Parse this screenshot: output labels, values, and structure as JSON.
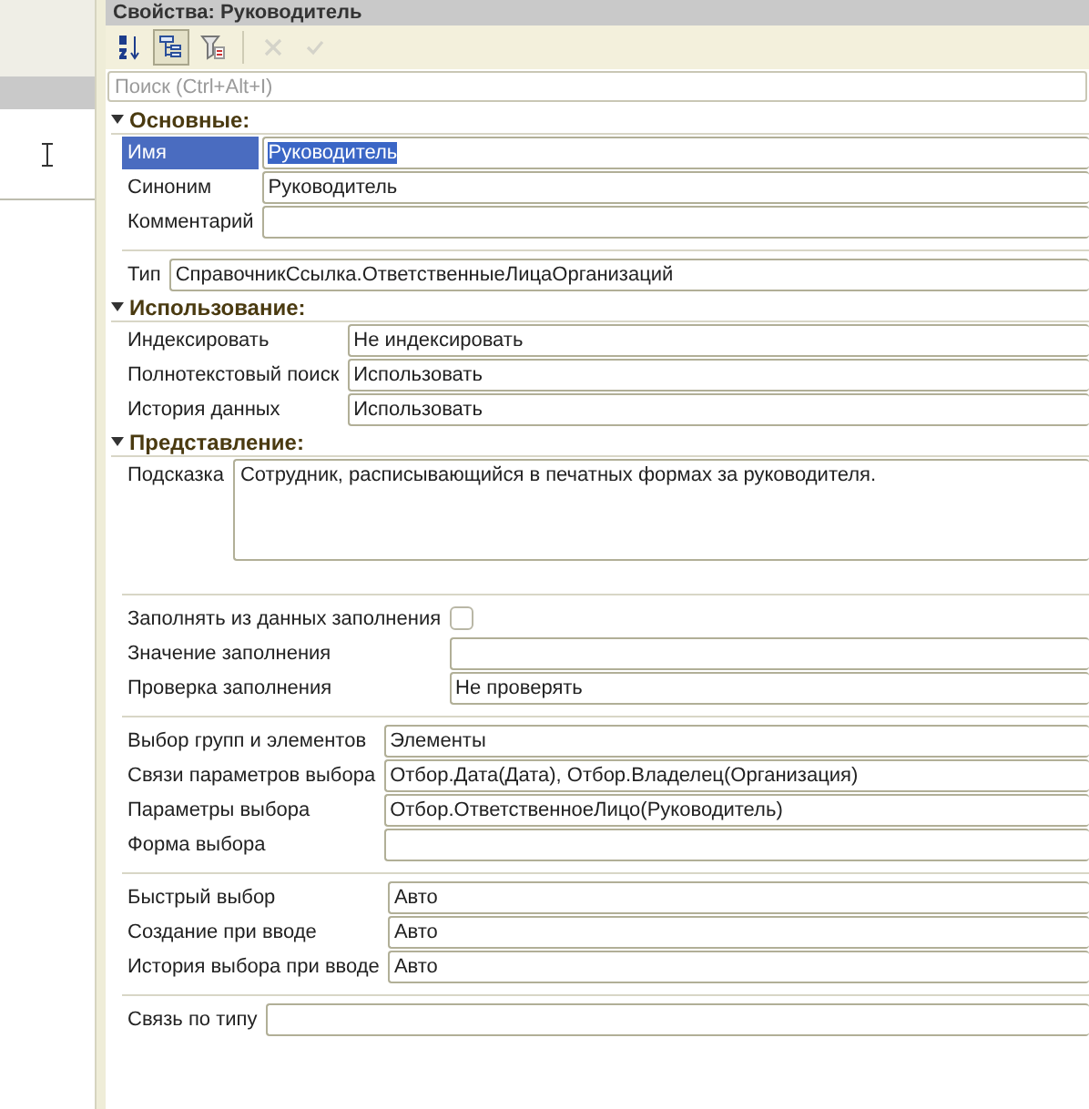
{
  "window": {
    "title": "Свойства: Руководитель"
  },
  "toolbar": [
    {
      "kind": "sort",
      "pressed": false,
      "disabled": false
    },
    {
      "kind": "tree",
      "pressed": true,
      "disabled": false
    },
    {
      "kind": "filter",
      "pressed": false,
      "disabled": false
    },
    {
      "kind": "delete",
      "pressed": false,
      "disabled": true
    },
    {
      "kind": "apply",
      "pressed": false,
      "disabled": true
    }
  ],
  "search": {
    "placeholder": "Поиск (Ctrl+Alt+I)"
  },
  "groups": [
    {
      "header": "Основные:",
      "expanded": true,
      "rows": [
        {
          "kind": "field",
          "label": "Имя",
          "value": "Руководитель",
          "selected": true
        },
        {
          "kind": "field",
          "label": "Синоним",
          "value": "Руководитель",
          "selected": false
        },
        {
          "kind": "field",
          "label": "Комментарий",
          "selected": false
        }
      ]
    },
    {
      "rows": [
        {
          "kind": "field",
          "label": "Тип",
          "value": "СправочникСсылка.ОтветственныеЛицаОрганизаций",
          "selected": false
        }
      ]
    },
    {
      "header": "Использование:",
      "expanded": true,
      "rows": [
        {
          "kind": "field",
          "label": "Индексировать",
          "value": "Не индексировать",
          "selected": false
        },
        {
          "kind": "field",
          "label": "Полнотекстовый поиск",
          "value": "Использовать",
          "selected": false
        },
        {
          "kind": "field",
          "label": "История данных",
          "value": "Использовать",
          "selected": false
        }
      ]
    },
    {
      "header": "Представление:",
      "expanded": true,
      "rows": [
        {
          "kind": "textarea",
          "label": "Подсказка",
          "value": "Сотрудник, расписывающийся в печатных формах за руководителя.",
          "selected": false
        }
      ]
    },
    {
      "rows": [
        {
          "kind": "checkbox",
          "label": "Заполнять из данных заполнения",
          "checked": false,
          "selected": false
        },
        {
          "kind": "field",
          "label": "Значение заполнения",
          "selected": false
        },
        {
          "kind": "field",
          "label": "Проверка заполнения",
          "value": "Не проверять",
          "selected": false
        }
      ]
    },
    {
      "rows": [
        {
          "kind": "field",
          "label": "Выбор групп и элементов",
          "value": "Элементы",
          "selected": false
        },
        {
          "kind": "field",
          "label": "Связи параметров выбора",
          "value": "Отбор.Дата(Дата), Отбор.Владелец(Организация)",
          "selected": false
        },
        {
          "kind": "field",
          "label": "Параметры выбора",
          "value": "Отбор.ОтветственноеЛицо(Руководитель)",
          "selected": false
        },
        {
          "kind": "field",
          "label": "Форма выбора",
          "selected": false
        }
      ]
    },
    {
      "rows": [
        {
          "kind": "field",
          "label": "Быстрый выбор",
          "value": "Авто",
          "selected": false
        },
        {
          "kind": "field",
          "label": "Создание при вводе",
          "value": "Авто",
          "selected": false
        },
        {
          "kind": "field",
          "label": "История выбора при вводе",
          "value": "Авто",
          "selected": false
        }
      ]
    },
    {
      "rows": [
        {
          "kind": "field",
          "label": "Связь по типу",
          "selected": false
        }
      ]
    }
  ]
}
